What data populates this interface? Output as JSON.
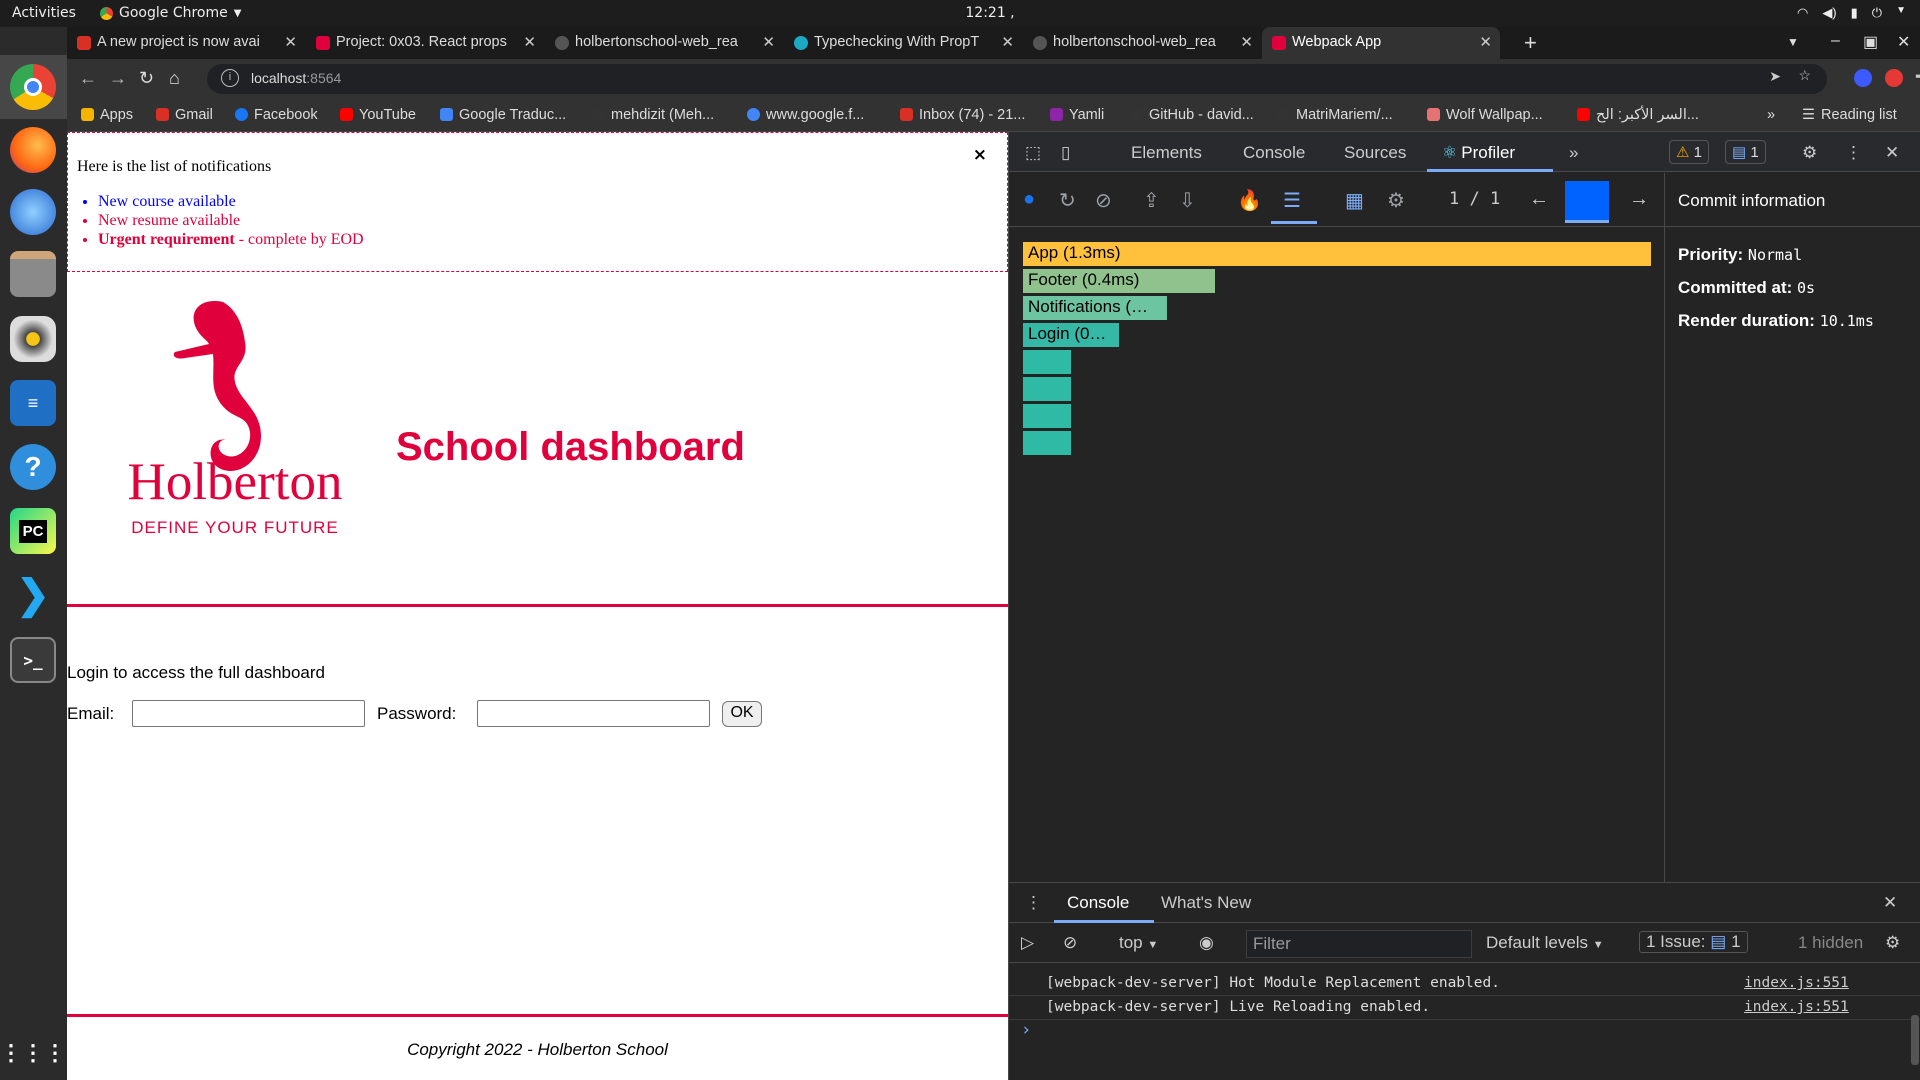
{
  "os": {
    "activities": "Activities",
    "app_name": "Google Chrome",
    "clock": "12:21 ,"
  },
  "browser": {
    "tabs": [
      {
        "title": "A new project is now avai",
        "icon_color": "#d93025"
      },
      {
        "title": "Project: 0x03. React props",
        "icon_color": "#e0003c"
      },
      {
        "title": "holbertonschool-web_rea",
        "icon_color": "#555555"
      },
      {
        "title": "Typechecking With PropT",
        "icon_color": "#1ba9c5"
      },
      {
        "title": "holbertonschool-web_rea",
        "icon_color": "#555555"
      },
      {
        "title": "Webpack App",
        "icon_color": "#e0003c"
      }
    ],
    "url_host": "localhost",
    "url_port": ":8564",
    "bookmarks": [
      {
        "label": "Apps",
        "color": "#f4b400"
      },
      {
        "label": "Gmail",
        "color": "#d93025"
      },
      {
        "label": "Facebook",
        "color": "#1877f2"
      },
      {
        "label": "YouTube",
        "color": "#ff0000"
      },
      {
        "label": "Google Traduc...",
        "color": "#4285f4"
      },
      {
        "label": "mehdizit (Meh...",
        "color": "#333333"
      },
      {
        "label": "www.google.f...",
        "color": "#4285f4"
      },
      {
        "label": "Inbox (74) - 21...",
        "color": "#d93025"
      },
      {
        "label": "Yamli",
        "color": "#8e24aa"
      },
      {
        "label": "GitHub - david...",
        "color": "#333333"
      },
      {
        "label": "MatriMariem/...",
        "color": "#333333"
      },
      {
        "label": "Wolf Wallpap...",
        "color": "#e57373"
      },
      {
        "label": "السر الأكبر: الح...",
        "color": "#ff0000"
      }
    ],
    "bookmarks_overflow": "»",
    "reading_list": "Reading list"
  },
  "page": {
    "notifications": {
      "title": "Here is the list of notifications",
      "close": "×",
      "items": [
        {
          "text": "New course available",
          "type": "default"
        },
        {
          "text": "New resume available",
          "type": "urgent"
        },
        {
          "bold": "Urgent requirement",
          "rest": " - complete by EOD",
          "type": "urgent"
        }
      ]
    },
    "header": {
      "logo_word": "Holberton",
      "logo_tagline": "DEFINE YOUR FUTURE",
      "title": "School dashboard"
    },
    "login": {
      "intro": "Login to access the full dashboard",
      "email_label": "Email:",
      "password_label": "Password:",
      "ok": "OK"
    },
    "footer": "Copyright 2022 - Holberton School",
    "accent_color": "#e0003c"
  },
  "devtools": {
    "tabs": [
      "Elements",
      "Console",
      "Sources",
      "Profiler"
    ],
    "active_tab": "Profiler",
    "warnings": "1",
    "messages": "1",
    "commit_counter": "1 / 1",
    "flame_nodes": [
      {
        "label": "App (1.3ms)",
        "color": "#ffc13b"
      },
      {
        "label": "Footer (0.4ms)",
        "color": "#8fc28d"
      },
      {
        "label": "Notifications (…",
        "color": "#6dc4a0"
      },
      {
        "label": "Login (0…",
        "color": "#35b8a6"
      },
      {
        "label": "",
        "color": "#2fbaa5"
      },
      {
        "label": "",
        "color": "#2fbaa5"
      },
      {
        "label": "",
        "color": "#2fbaa5"
      },
      {
        "label": "",
        "color": "#2fbaa5"
      }
    ],
    "commit_info": {
      "header": "Commit information",
      "priority_label": "Priority",
      "priority_value": "Normal",
      "committed_label": "Committed at",
      "committed_value": "0s",
      "render_label": "Render duration",
      "render_value": "10.1ms"
    },
    "drawer": {
      "tabs": [
        "Console",
        "What's New"
      ],
      "context": "top",
      "filter_placeholder": "Filter",
      "levels": "Default levels",
      "issues_label": "1 Issue:",
      "issues_count": "1",
      "hidden": "1 hidden",
      "logs": [
        {
          "text": "[webpack-dev-server] Hot Module Replacement enabled.",
          "source": "index.js:551"
        },
        {
          "text": "[webpack-dev-server] Live Reloading enabled.",
          "source": "index.js:551"
        }
      ],
      "prompt": "›"
    }
  }
}
